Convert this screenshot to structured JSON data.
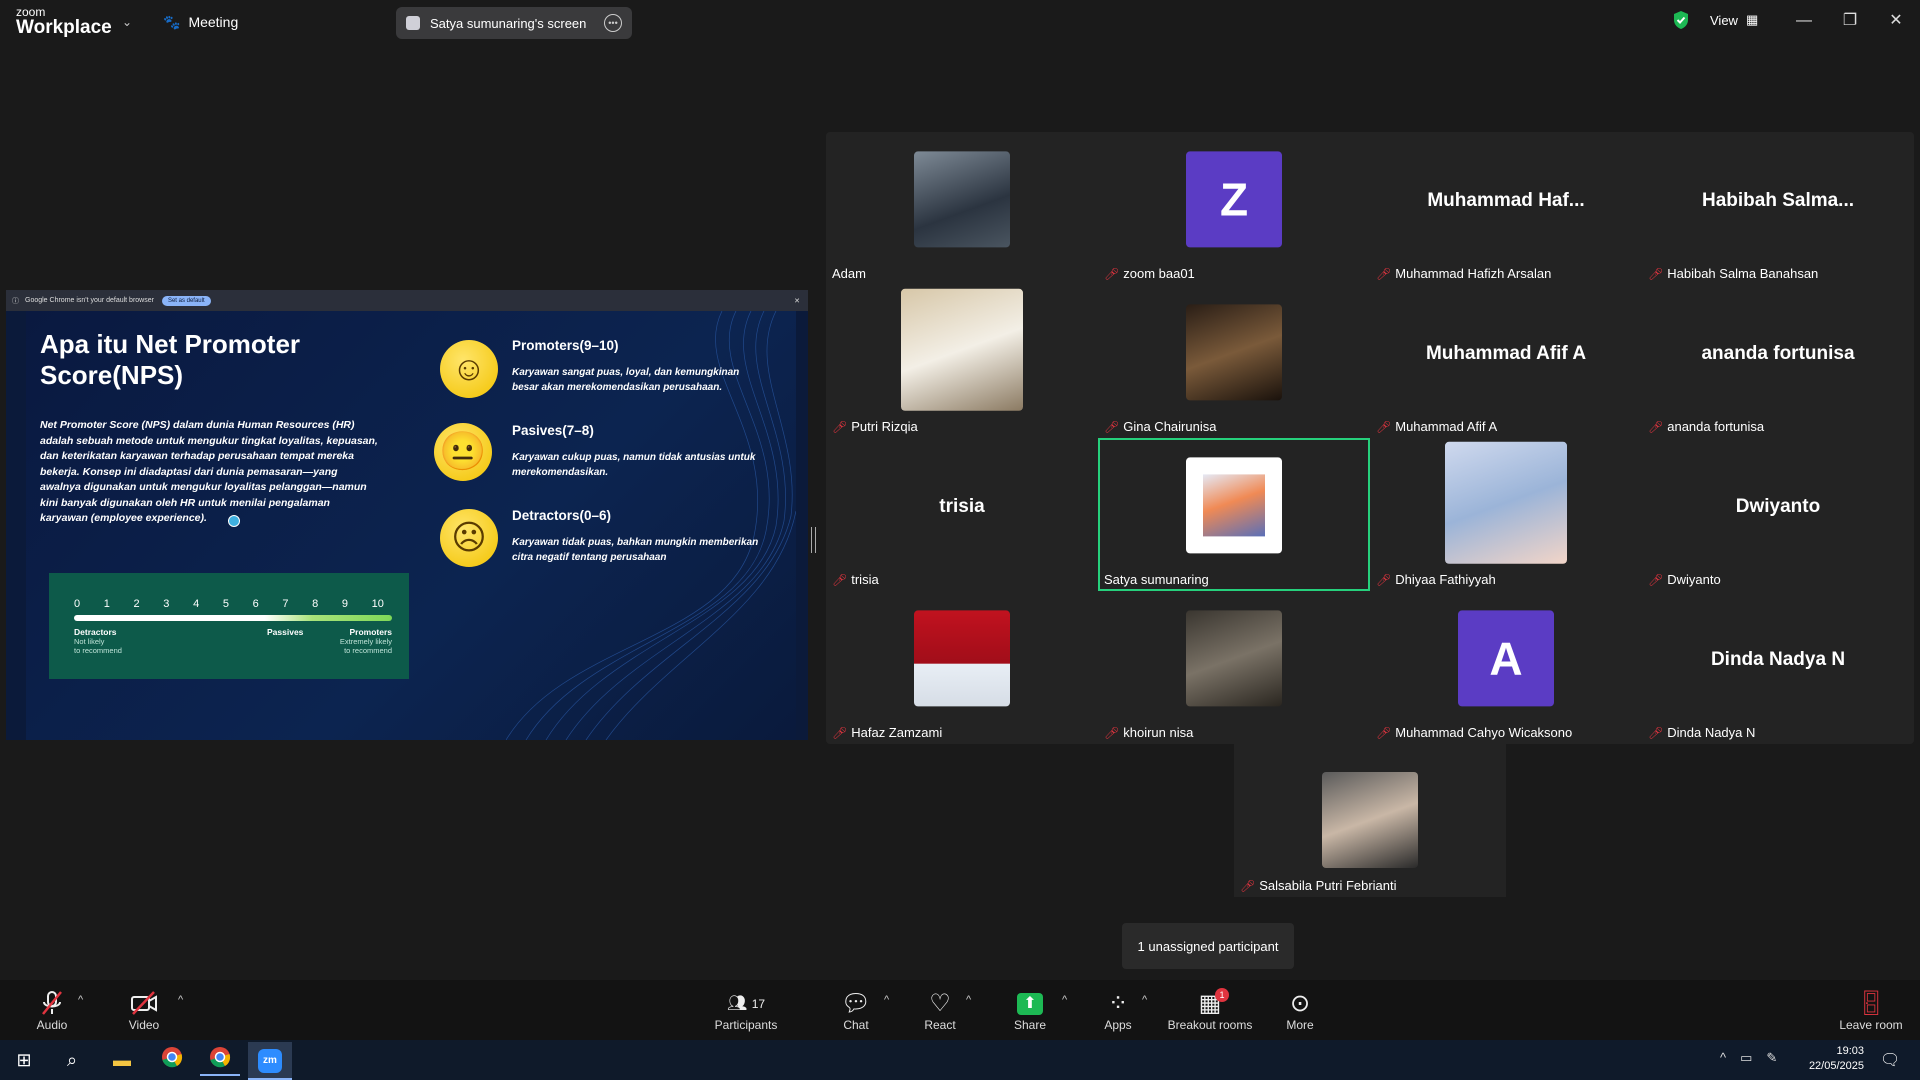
{
  "titlebar": {
    "logo_top": "zoom",
    "logo_bottom": "Workplace",
    "meeting_label": "Meeting",
    "screen_pill": "Satya sumunaring's screen",
    "view_label": "View"
  },
  "shared_screen": {
    "chrome_notice": "Google Chrome isn't your default browser",
    "chrome_button": "Set as default",
    "slide_title": "Apa itu Net Promoter Score(NPS)",
    "slide_body": "Net Promoter Score (NPS) dalam dunia Human Resources (HR) adalah sebuah metode untuk mengukur tingkat loyalitas, kepuasan, dan keterikatan karyawan terhadap perusahaan tempat mereka bekerja. Konsep ini diadaptasi dari dunia pemasaran—yang awalnya digunakan untuk mengukur loyalitas pelanggan—namun kini banyak digunakan oleh HR untuk menilai pengalaman karyawan (employee experience).",
    "categories": [
      {
        "title": "Promoters(9–10)",
        "desc": "Karyawan sangat puas, loyal, dan kemungkinan besar akan merekomendasikan perusahaan.",
        "face": "☺"
      },
      {
        "title": "Pasives(7–8)",
        "desc": "Karyawan cukup puas, namun tidak antusias untuk merekomendasikan.",
        "face": "😐"
      },
      {
        "title": "Detractors(0–6)",
        "desc": "Karyawan tidak puas, bahkan mungkin memberikan citra negatif tentang perusahaan",
        "face": "☹"
      }
    ],
    "scale_numbers": [
      "0",
      "1",
      "2",
      "3",
      "4",
      "5",
      "6",
      "7",
      "8",
      "9",
      "10"
    ],
    "scale_left": "Detractors",
    "scale_left_sub1": "Not likely",
    "scale_left_sub2": "to recommend",
    "scale_mid": "Passives",
    "scale_right": "Promoters",
    "scale_right_sub1": "Extremely likely",
    "scale_right_sub2": "to recommend"
  },
  "participants": [
    {
      "name": "Adam",
      "kind": "photo",
      "muted": false
    },
    {
      "name": "zoom baa01",
      "kind": "letter",
      "letter": "Z",
      "muted": true
    },
    {
      "name": "Muhammad Hafizh Arsalan",
      "kind": "text",
      "big": "Muhammad  Haf...",
      "muted": true
    },
    {
      "name": "Habibah Salma Banahsan",
      "kind": "text",
      "big": "Habibah  Salma...",
      "muted": true
    },
    {
      "name": "Putri Rizqia",
      "kind": "photo",
      "muted": true
    },
    {
      "name": "Gina Chairunisa",
      "kind": "photo",
      "muted": true
    },
    {
      "name": "Muhammad Afif A",
      "kind": "text",
      "big": "Muhammad Afif A",
      "muted": true
    },
    {
      "name": "ananda fortunisa",
      "kind": "text",
      "big": "ananda fortunisa",
      "muted": true
    },
    {
      "name": "trisia",
      "kind": "text",
      "big": "trisia",
      "muted": true
    },
    {
      "name": "Satya sumunaring",
      "kind": "photo",
      "muted": false,
      "active": true
    },
    {
      "name": "Dhiyaa Fathiyyah",
      "kind": "photo",
      "muted": true
    },
    {
      "name": "Dwiyanto",
      "kind": "text",
      "big": "Dwiyanto",
      "muted": true
    },
    {
      "name": "Hafaz Zamzami",
      "kind": "photo",
      "muted": true
    },
    {
      "name": "khoirun nisa",
      "kind": "photo",
      "muted": true
    },
    {
      "name": "Muhammad Cahyo Wicaksono",
      "kind": "letter",
      "letter": "A",
      "muted": true
    },
    {
      "name": "Dinda Nadya N",
      "kind": "text",
      "big": "Dinda Nadya N",
      "muted": true
    }
  ],
  "extra_participant": {
    "name": "Salsabila Putri Febrianti",
    "muted": true
  },
  "unassigned": "1 unassigned participant",
  "toolbar": {
    "audio": "Audio",
    "video": "Video",
    "participants": "Participants",
    "participants_count": "17",
    "chat": "Chat",
    "react": "React",
    "share": "Share",
    "apps": "Apps",
    "breakout": "Breakout rooms",
    "breakout_badge": "1",
    "more": "More",
    "leave": "Leave room"
  },
  "taskbar": {
    "time": "19:03",
    "date": "22/05/2025"
  },
  "colors": {
    "active_border": "#26d07c",
    "muted_icon": "#e0343f",
    "avatar_purple": "#5b3cc4",
    "share_green": "#1db954"
  }
}
